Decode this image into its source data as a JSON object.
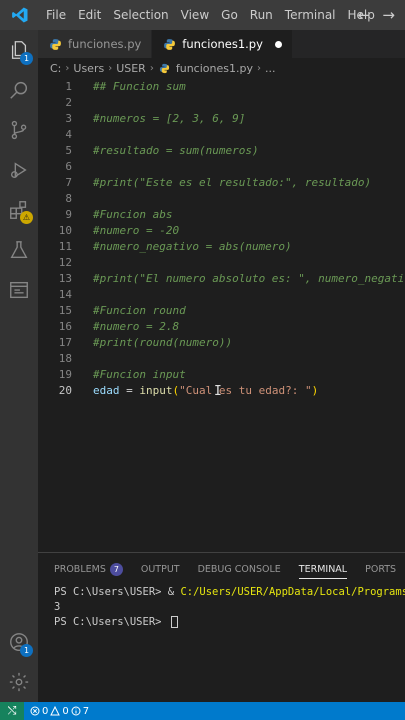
{
  "menu": [
    "File",
    "Edit",
    "Selection",
    "View",
    "Go",
    "Run",
    "Terminal",
    "Help"
  ],
  "nav": {
    "back": "←",
    "forward": "→"
  },
  "activity": {
    "explorer_badge": "1",
    "extensions_badge": "⚠",
    "accounts_badge": "1"
  },
  "tabs": [
    {
      "label": "funciones.py",
      "active": false
    },
    {
      "label": "funciones1.py",
      "active": true
    }
  ],
  "breadcrumb": [
    "C:",
    "Users",
    "USER",
    "funciones1.py",
    "..."
  ],
  "editor": {
    "lines": [
      {
        "n": "1",
        "text": "## Funcion sum"
      },
      {
        "n": "2",
        "text": ""
      },
      {
        "n": "3",
        "text": "#numeros = [2, 3, 6, 9]"
      },
      {
        "n": "4",
        "text": ""
      },
      {
        "n": "5",
        "text": "#resultado = sum(numeros)"
      },
      {
        "n": "6",
        "text": ""
      },
      {
        "n": "7",
        "text": "#print(\"Este es el resultado:\", resultado)"
      },
      {
        "n": "8",
        "text": ""
      },
      {
        "n": "9",
        "text": "#Funcion abs"
      },
      {
        "n": "10",
        "text": "#numero = -20"
      },
      {
        "n": "11",
        "text": "#numero_negativo = abs(numero)"
      },
      {
        "n": "12",
        "text": ""
      },
      {
        "n": "13",
        "text": "#print(\"El numero absoluto es: \", numero_negativo)"
      },
      {
        "n": "14",
        "text": ""
      },
      {
        "n": "15",
        "text": "#Funcion round"
      },
      {
        "n": "16",
        "text": "#numero = 2.8"
      },
      {
        "n": "17",
        "text": "#print(round(numero))"
      },
      {
        "n": "18",
        "text": ""
      },
      {
        "n": "19",
        "text": "#Funcion input"
      }
    ],
    "current_line": {
      "n": "20",
      "var": "edad",
      "op": " = ",
      "fn": "input",
      "open": "(",
      "str": "\"Cual es tu edad?: \"",
      "close": ")"
    }
  },
  "panel": {
    "tabs": [
      {
        "label": "PROBLEMS",
        "badge": "7"
      },
      {
        "label": "OUTPUT"
      },
      {
        "label": "DEBUG CONSOLE"
      },
      {
        "label": "TERMINAL",
        "active": true
      },
      {
        "label": "PORTS"
      }
    ],
    "terminal": {
      "line1_prompt": "PS C:\\Users\\USER> & ",
      "line1_path": "C:/Users/USER/AppData/Local/Programs/Python",
      "line2": "3",
      "line3_prompt": "PS C:\\Users\\USER> "
    }
  },
  "status": {
    "remote": "⤭",
    "errors": "0",
    "warnings": "0",
    "info": "7"
  }
}
